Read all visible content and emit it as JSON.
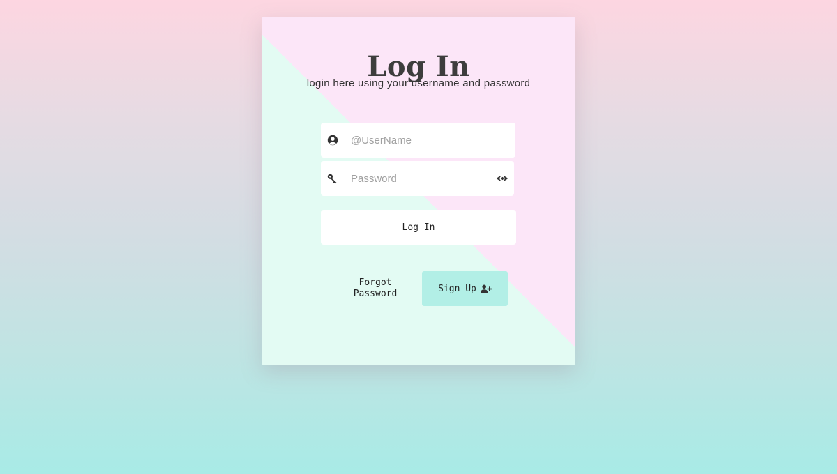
{
  "form": {
    "title": "Log In",
    "subtitle": "login here using your username and password",
    "username": {
      "placeholder": "@UserName",
      "value": "",
      "icon": "user-circle-icon"
    },
    "password": {
      "placeholder": "Password",
      "value": "",
      "icon": "key-icon",
      "toggle_icon": "eye-icon"
    },
    "login_button": "Log In",
    "forgot_link": "Forgot Password",
    "signup_button": "Sign Up",
    "signup_icon": "user-plus-icon"
  },
  "colors": {
    "background_top": "#fdd6e1",
    "background_bottom": "#a8ebe6",
    "card_mint": "#e3fbf3",
    "card_pink": "#fce6f8",
    "signup_button": "#b2efe6",
    "text_dark": "#3d3d3d"
  }
}
